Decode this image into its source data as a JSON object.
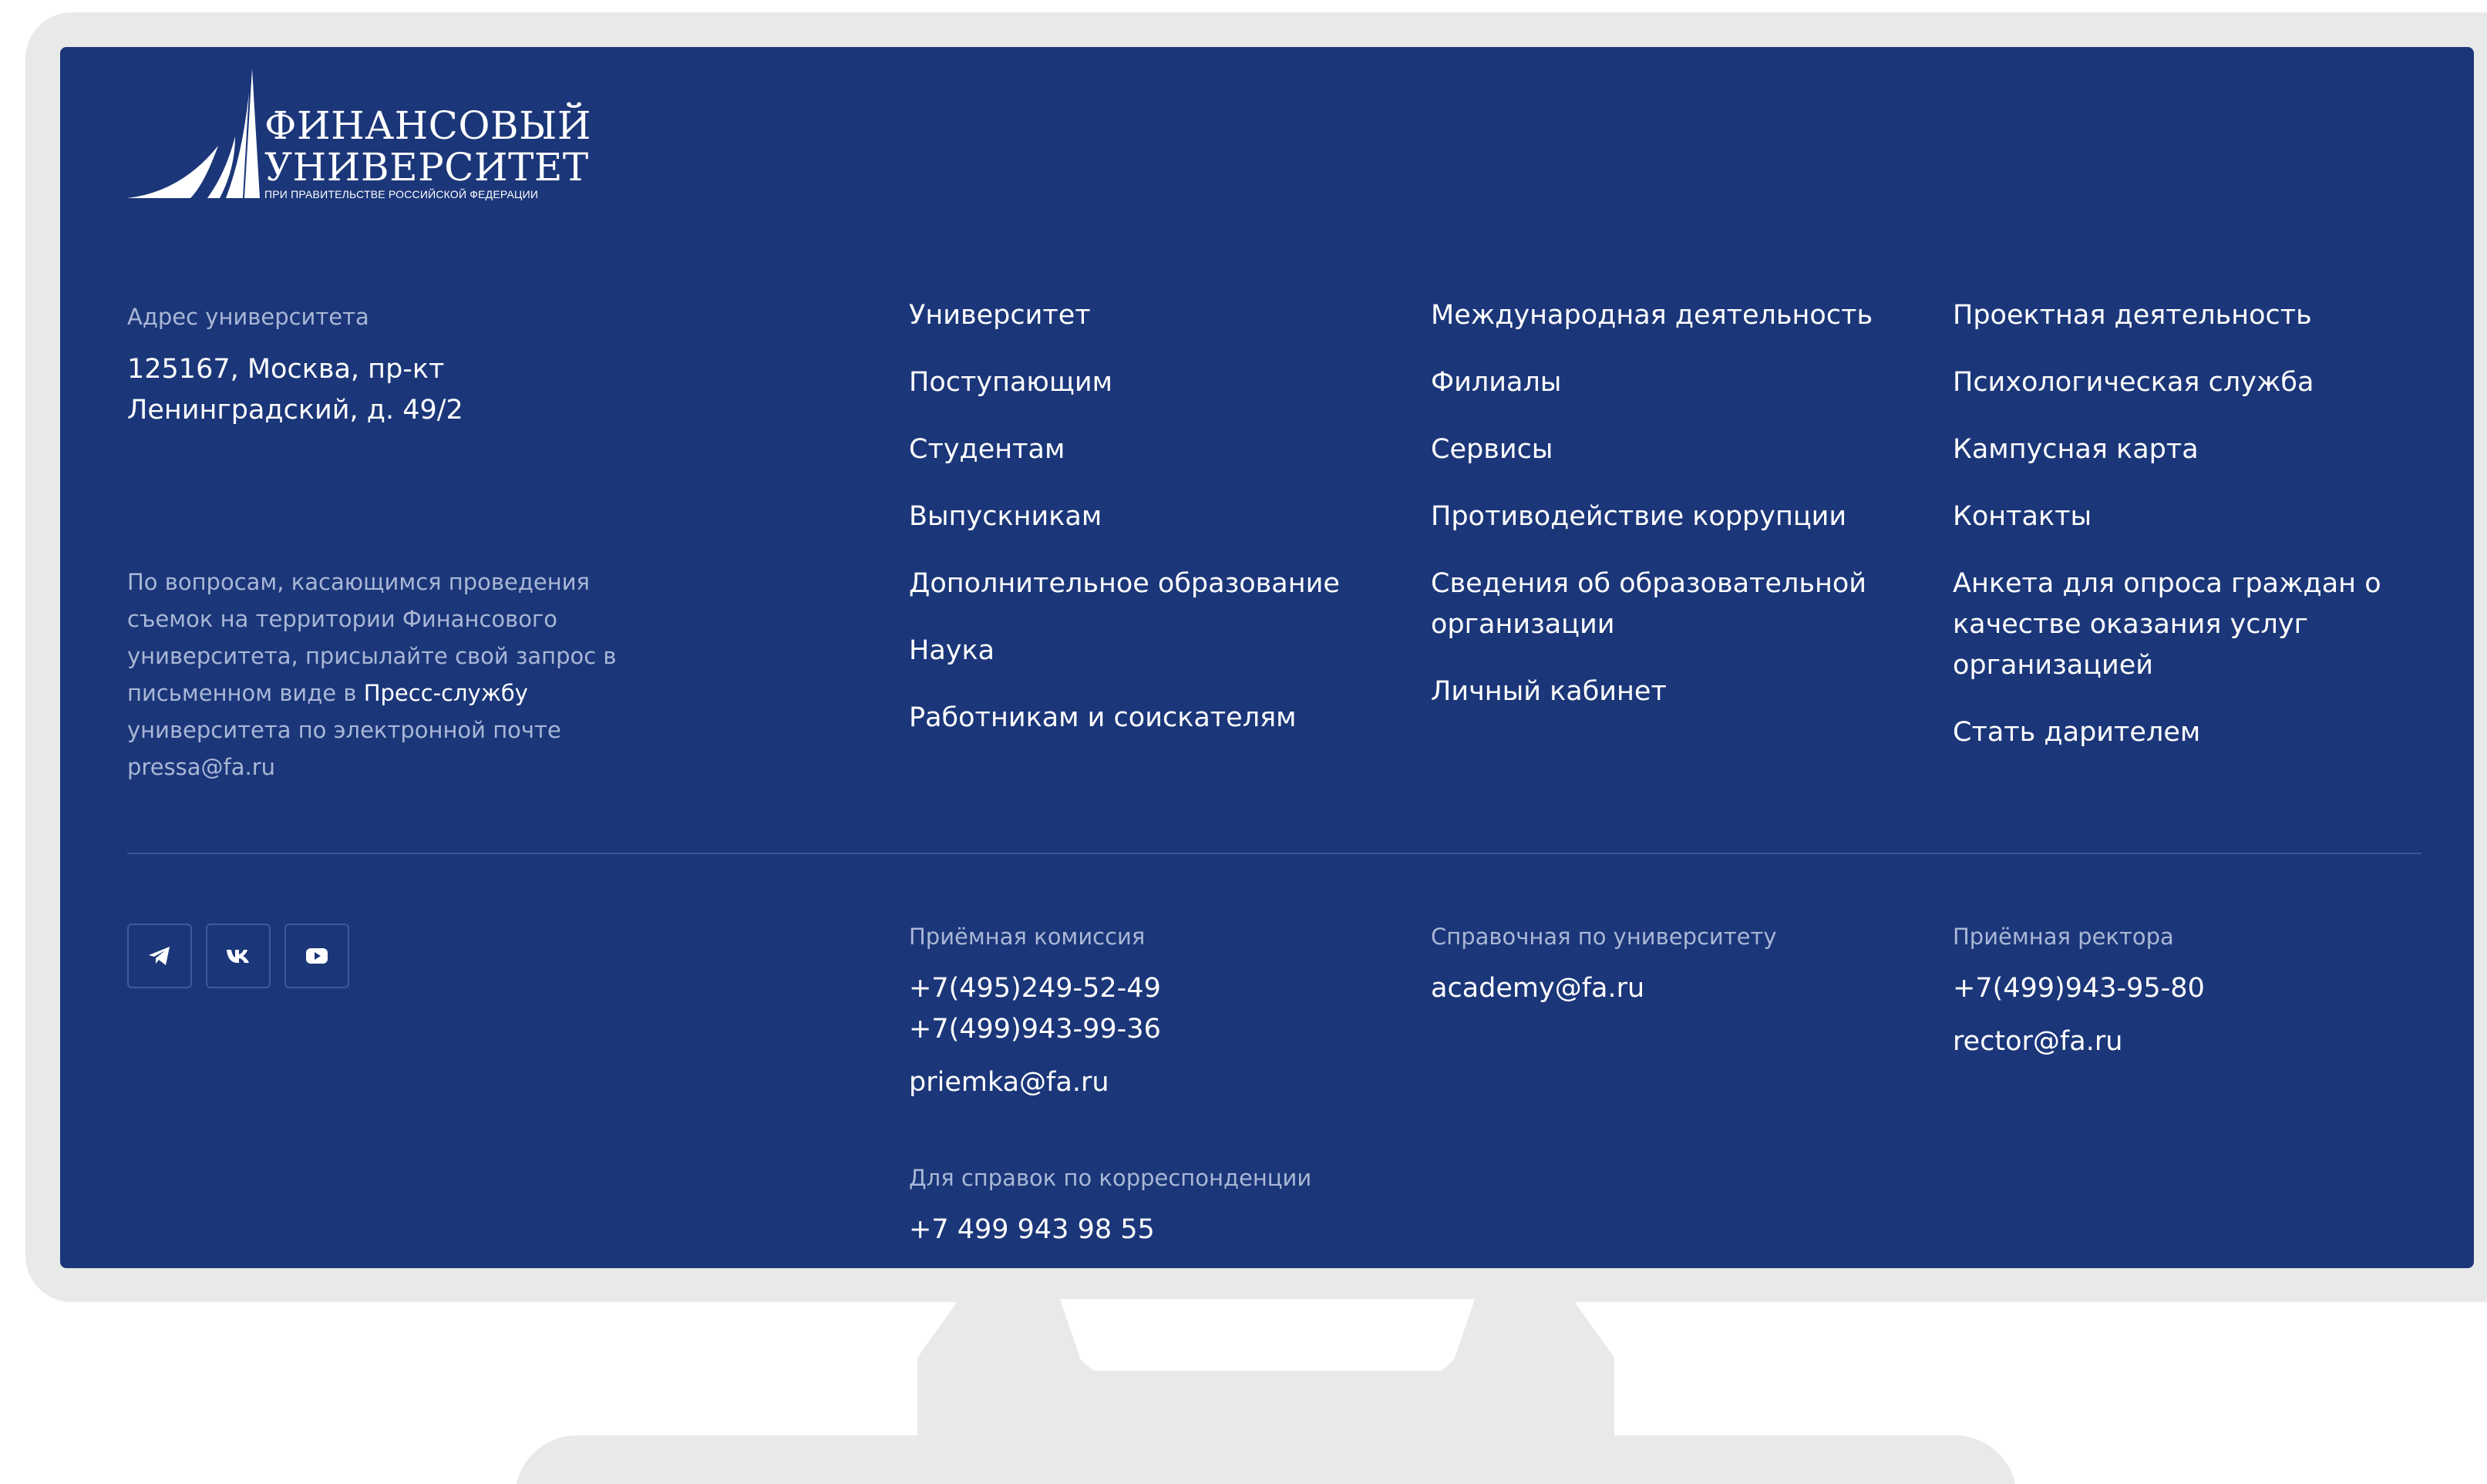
{
  "logo": {
    "line1": "ФИНАНСОВЫЙ",
    "line2": "УНИВЕРСИТЕТ",
    "sub": "ПРИ ПРАВИТЕЛЬСТВЕ РОССИЙСКОЙ ФЕДЕРАЦИИ"
  },
  "address": {
    "label": "Адрес университета",
    "value": "125167, Москва, пр-кт Ленинградский, д. 49/2"
  },
  "press": {
    "text_before": "По вопросам, касающимся проведения съемок на территории Финансового университета, присылайте свой запрос в письменном виде в ",
    "link": "Пресс-службу",
    "text_after": " университета по электронной почте pressa@fa.ru"
  },
  "nav": {
    "col1": [
      "Университет",
      "Поступающим",
      "Студентам",
      "Выпускникам",
      "Дополнительное образование",
      "Наука",
      "Работникам и соискателям"
    ],
    "col2": [
      "Международная деятельность",
      "Филиалы",
      "Сервисы",
      "Противодействие коррупции",
      "Сведения об образовательной организации",
      "Личный кабинет"
    ],
    "col3": [
      "Проектная деятельность",
      "Психологическая служба",
      "Кампусная карта",
      "Контакты",
      "Анкета для опроса граждан о качестве оказания услуг организацией",
      "Стать дарителем"
    ]
  },
  "socials": [
    {
      "icon": "telegram-icon"
    },
    {
      "icon": "vk-icon"
    },
    {
      "icon": "youtube-icon"
    }
  ],
  "contacts": {
    "admission": {
      "label": "Приёмная комиссия",
      "phone1": "+7(495)249-52-49",
      "phone2": "+7(499)943-99-36",
      "email": "priemka@fa.ru"
    },
    "reference": {
      "label": "Справочная по университету",
      "email": "academy@fa.ru"
    },
    "rector": {
      "label": "Приёмная ректора",
      "phone": "+7(499)943-95-80",
      "email": "rector@fa.ru"
    },
    "correspondence": {
      "label": "Для справок по корреспонденции",
      "phone": "+7 499 943 98 55"
    }
  },
  "colors": {
    "footer_bg": "#1b3679",
    "muted_text": "#a9b7d6",
    "monitor": "#e8e9e9"
  }
}
